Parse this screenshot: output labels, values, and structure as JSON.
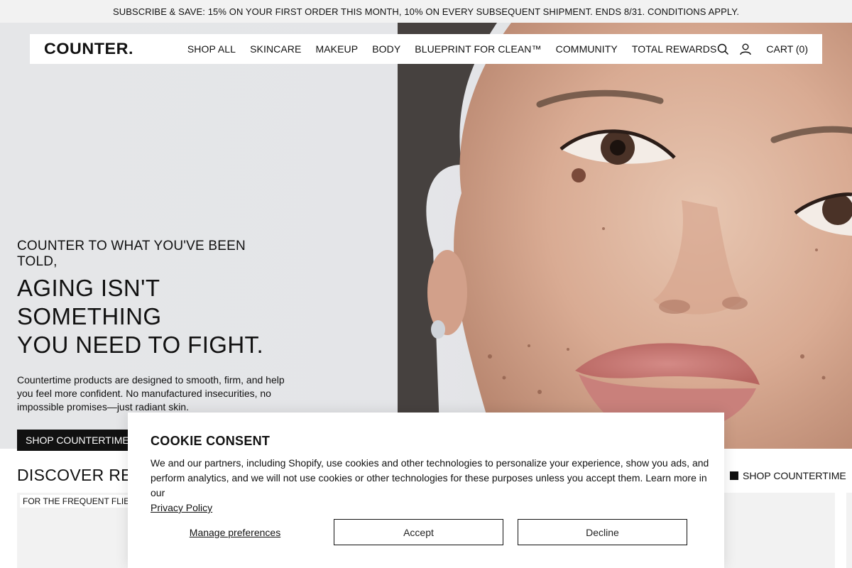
{
  "announcement": "SUBSCRIBE & SAVE: 15% ON YOUR FIRST ORDER THIS MONTH, 10% ON EVERY SUBSEQUENT SHIPMENT. ENDS 8/31. CONDITIONS APPLY.",
  "nav": {
    "logo": "COUNTER.",
    "links": [
      "SHOP ALL",
      "SKINCARE",
      "MAKEUP",
      "BODY",
      "BLUEPRINT FOR CLEAN™",
      "COMMUNITY",
      "TOTAL REWARDS"
    ],
    "icons": {
      "search": "search-icon",
      "account": "account-icon"
    },
    "cart_label": "CART (0)"
  },
  "hero": {
    "eyebrow": "COUNTER TO WHAT YOU'VE BEEN TOLD,",
    "headline_line1": "AGING ISN'T SOMETHING",
    "headline_line2": "YOU NEED TO FIGHT.",
    "body": "Countertime products are designed to smooth, firm, and help you feel more confident. No manufactured insecurities, no impossible promises—just radiant skin.",
    "cta": "SHOP COUNTERTIME"
  },
  "discover": {
    "title": "DISCOVER RETIN",
    "shop_link": "SHOP COUNTERTIME",
    "card_tag": "FOR THE FREQUENT FLIER"
  },
  "cookie": {
    "title": "COOKIE CONSENT",
    "text": "We and our partners, including Shopify, use cookies and other technologies to personalize your experience, show you ads, and perform analytics, and we will not use cookies or other technologies for these purposes unless you accept them. Learn more in our",
    "link": "Privacy Policy",
    "manage": "Manage preferences",
    "accept": "Accept",
    "decline": "Decline"
  },
  "colors": {
    "announcement_bg": "#f2f2f2",
    "text": "#111111",
    "button_bg": "#111111",
    "hero_bg": "#e6e7e9"
  }
}
